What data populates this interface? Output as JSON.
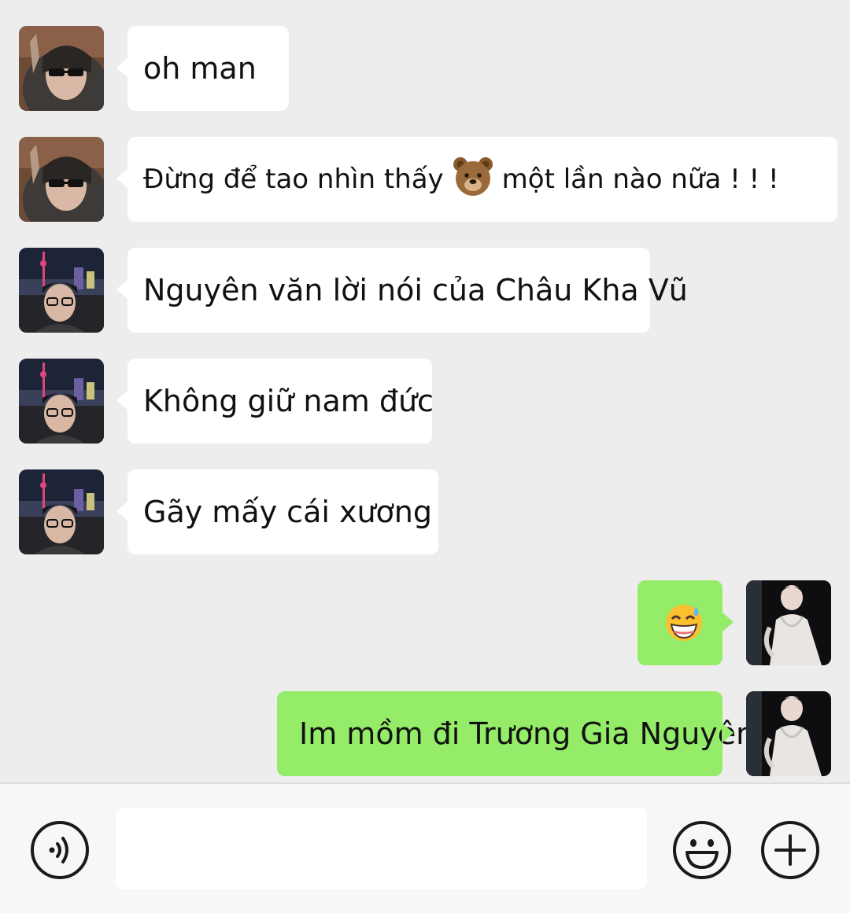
{
  "messages": [
    {
      "side": "left",
      "sender": "friend-1",
      "text": "oh man"
    },
    {
      "side": "left",
      "sender": "friend-1",
      "text_before": "Đừng để tao nhìn thấy",
      "emoji": "bear-face",
      "text_after": "một lần nào nữa ! ! !"
    },
    {
      "side": "left",
      "sender": "friend-2",
      "text": "Nguyên văn lời nói của Châu Kha Vũ"
    },
    {
      "side": "left",
      "sender": "friend-2",
      "text": "Không giữ nam đức"
    },
    {
      "side": "left",
      "sender": "friend-2",
      "text": "Gãy mấy cái xương"
    },
    {
      "side": "right",
      "sender": "me",
      "emoji": "grinning-sweat-face"
    },
    {
      "side": "right",
      "sender": "me",
      "text": "Im mồm đi Trương Gia Nguyên"
    }
  ],
  "input_bar": {
    "message_value": "",
    "icons": [
      "voice-icon",
      "emoji-icon",
      "plus-icon"
    ]
  },
  "colors": {
    "background": "#ededed",
    "incoming_bubble": "#ffffff",
    "outgoing_bubble": "#95ec69",
    "input_bar": "#f7f7f7"
  }
}
